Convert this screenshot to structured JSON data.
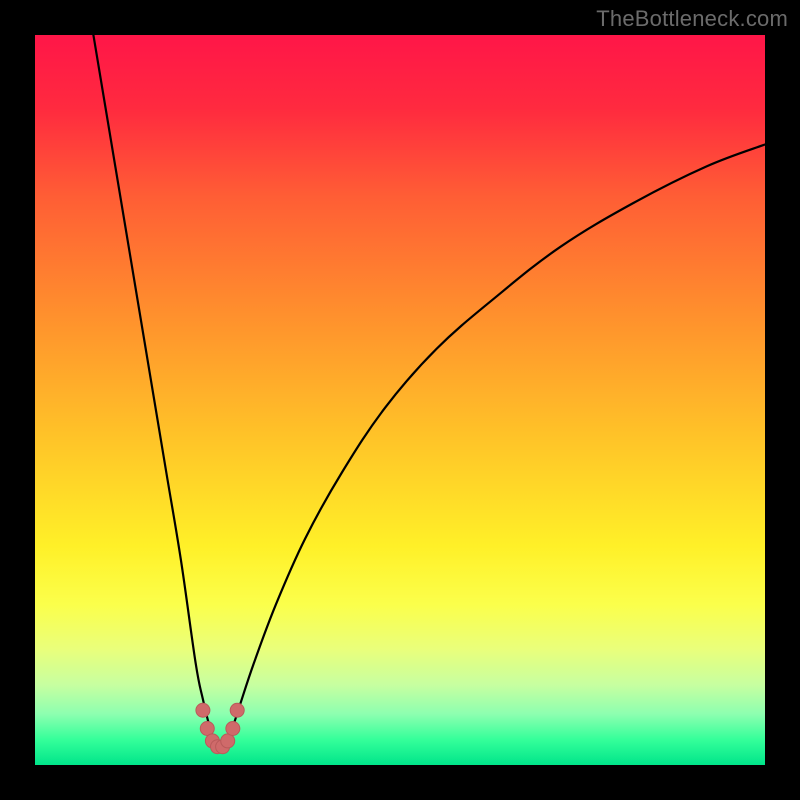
{
  "watermark": {
    "text": "TheBottleneck.com"
  },
  "colors": {
    "frame": "#000000",
    "curve": "#000000",
    "marker_fill": "#cf6a6a",
    "marker_stroke": "#b95a5a",
    "gradient_stops": [
      {
        "offset": 0.0,
        "color": "#ff1648"
      },
      {
        "offset": 0.1,
        "color": "#ff2a3f"
      },
      {
        "offset": 0.22,
        "color": "#ff5d35"
      },
      {
        "offset": 0.38,
        "color": "#ff8f2d"
      },
      {
        "offset": 0.55,
        "color": "#ffc328"
      },
      {
        "offset": 0.7,
        "color": "#fff028"
      },
      {
        "offset": 0.78,
        "color": "#fbff4b"
      },
      {
        "offset": 0.84,
        "color": "#eaff7a"
      },
      {
        "offset": 0.89,
        "color": "#c7ffa0"
      },
      {
        "offset": 0.93,
        "color": "#8dffb0"
      },
      {
        "offset": 0.965,
        "color": "#35ff9a"
      },
      {
        "offset": 1.0,
        "color": "#00e58a"
      }
    ]
  },
  "chart_data": {
    "type": "line",
    "title": "",
    "xlabel": "",
    "ylabel": "",
    "xlim": [
      0,
      100
    ],
    "ylim": [
      0,
      100
    ],
    "grid": false,
    "legend": false,
    "notes": "V-shaped bottleneck curve on vertical red→green gradient. Minimum at x≈25. Left branch rises steeply to top-left corner; right branch rises with decreasing slope toward upper-right. Small cluster of salmon markers at the trough.",
    "series": [
      {
        "name": "curve",
        "x": [
          8,
          10,
          12,
          14,
          16,
          18,
          20,
          22,
          23,
          24,
          25,
          26,
          27,
          28,
          30,
          33,
          37,
          42,
          48,
          55,
          63,
          72,
          82,
          92,
          100
        ],
        "y": [
          100,
          88,
          76,
          64,
          52,
          40,
          28,
          14,
          9,
          5,
          2.5,
          3,
          5,
          8,
          14,
          22,
          31,
          40,
          49,
          57,
          64,
          71,
          77,
          82,
          85
        ]
      }
    ],
    "markers": {
      "name": "trough-markers",
      "points": [
        {
          "x": 23.0,
          "y": 7.5
        },
        {
          "x": 23.6,
          "y": 5.0
        },
        {
          "x": 24.3,
          "y": 3.3
        },
        {
          "x": 25.0,
          "y": 2.5
        },
        {
          "x": 25.7,
          "y": 2.5
        },
        {
          "x": 26.4,
          "y": 3.3
        },
        {
          "x": 27.1,
          "y": 5.0
        },
        {
          "x": 27.7,
          "y": 7.5
        }
      ],
      "radius_px": 7
    }
  }
}
